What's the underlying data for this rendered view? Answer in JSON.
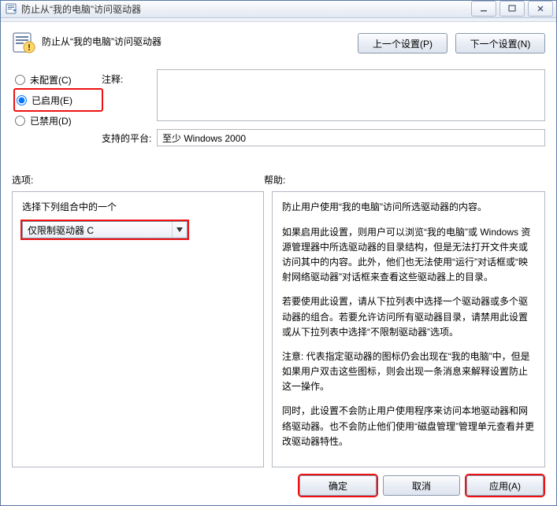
{
  "titlebar": {
    "text": "防止从“我的电脑”访问驱动器"
  },
  "header": {
    "title": "防止从“我的电脑”访问驱动器",
    "prev_label": "上一个设置(P)",
    "next_label": "下一个设置(N)"
  },
  "radios": {
    "not_configured": "未配置(C)",
    "enabled": "已启用(E)",
    "disabled": "已禁用(D)"
  },
  "fields": {
    "comment_label": "注释:",
    "platform_label": "支持的平台:",
    "platform_value": "至少 Windows 2000"
  },
  "sections": {
    "options": "选项:",
    "help": "帮助:"
  },
  "options": {
    "instruction": "选择下列组合中的一个",
    "selected": "仅限制驱动器 C"
  },
  "help": {
    "p1": "防止用户使用“我的电脑”访问所选驱动器的内容。",
    "p2": "如果启用此设置，则用户可以浏览“我的电脑”或 Windows 资源管理器中所选驱动器的目录结构，但是无法打开文件夹或访问其中的内容。此外，他们也无法使用“运行”对话框或“映射网络驱动器”对话框来查看这些驱动器上的目录。",
    "p3": "若要使用此设置，请从下拉列表中选择一个驱动器或多个驱动器的组合。若要允许访问所有驱动器目录，请禁用此设置或从下拉列表中选择“不限制驱动器”选项。",
    "p4": "注意: 代表指定驱动器的图标仍会出现在“我的电脑”中，但是如果用户双击这些图标，则会出现一条消息来解释设置防止这一操作。",
    "p5": "同时，此设置不会防止用户使用程序来访问本地驱动器和网络驱动器。也不会防止他们使用“磁盘管理”管理单元查看并更改驱动器特性。"
  },
  "footer": {
    "ok": "确定",
    "cancel": "取消",
    "apply": "应用(A)"
  }
}
